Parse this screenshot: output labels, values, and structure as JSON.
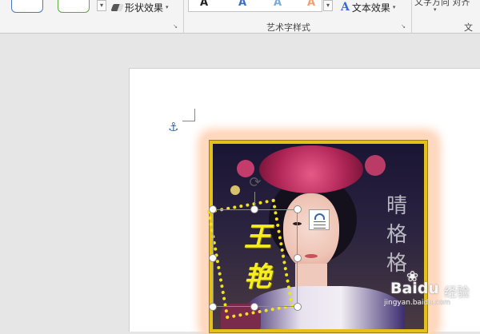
{
  "ribbon": {
    "shape_effect_label": "形状效果",
    "art_style_group_label": "艺术字样式",
    "text_effect_label": "文本效果",
    "text_group_label": "文",
    "wrap_partial_label": "文字方向 对齐",
    "dropdown_caret": "▾",
    "scroll_caret": "▾",
    "launcher_glyph": "↘",
    "art_gallery_glyphs": [
      "A",
      "A",
      "A",
      "A"
    ],
    "art_gallery_colors": [
      "#222222",
      "#3a6cc9",
      "#7aaad8",
      "#f0a070"
    ],
    "text_effect_icon": "A"
  },
  "document": {
    "anchor_icon": "⚓",
    "vertical_caption": "晴格格",
    "name_text": "王艳",
    "rotate_icon": "⟳"
  },
  "watermark": {
    "brand": "Baidu",
    "brand_paw": "❀",
    "sub": "经验",
    "url": "jingyan.baidu.com"
  },
  "colors": {
    "accent_blue": "#3b6cc9",
    "frame_gold": "#e3c01a",
    "name_yellow": "#f7ee20",
    "glow": "#ffcfb0"
  }
}
